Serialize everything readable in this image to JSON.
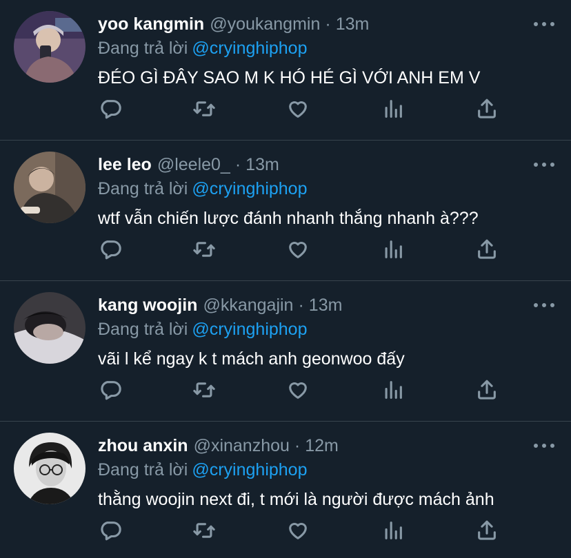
{
  "tweets": [
    {
      "name": "yoo kangmin",
      "handle": "@youkangmin",
      "dot": "·",
      "time": "13m",
      "reply_prefix": "Đang trả lời",
      "reply_to": "@cryinghiphop",
      "text": "ĐÉO GÌ ĐÂY SAO M K HÓ HÉ GÌ VỚI ANH EM V"
    },
    {
      "name": "lee leo",
      "handle": "@leele0_",
      "dot": "·",
      "time": "13m",
      "reply_prefix": "Đang trả lời",
      "reply_to": "@cryinghiphop",
      "text": "wtf vẫn chiến lược đánh nhanh thắng nhanh à???"
    },
    {
      "name": "kang woojin",
      "handle": "@kkangajin",
      "dot": "·",
      "time": "13m",
      "reply_prefix": "Đang trả lời",
      "reply_to": "@cryinghiphop",
      "text": "vãi l kể ngay k t mách anh geonwoo đấy"
    },
    {
      "name": "zhou anxin",
      "handle": "@xinanzhou",
      "dot": "·",
      "time": "12m",
      "reply_prefix": "Đang trả lời",
      "reply_to": "@cryinghiphop",
      "text": "thằng woojin next đi, t mới là người được mách ảnh"
    }
  ],
  "actions": [
    "reply-icon",
    "retweet-icon",
    "like-icon",
    "analytics-icon",
    "share-icon"
  ],
  "colors": {
    "background": "#15202b",
    "divider": "#38444d",
    "secondary_text": "#8899a6",
    "link": "#1da1f2"
  }
}
